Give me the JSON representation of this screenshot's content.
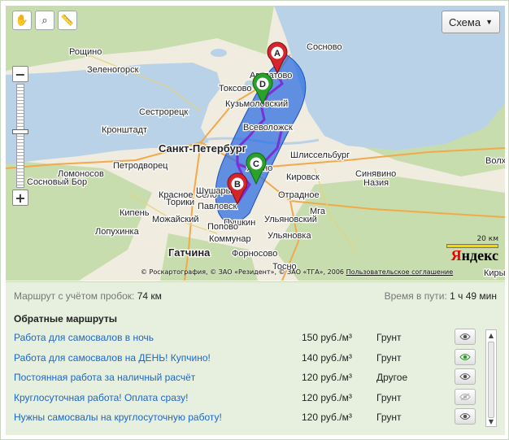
{
  "map": {
    "toolbar": [
      "hand-icon",
      "magnifier-icon",
      "ruler-icon"
    ],
    "map_type_label": "Схема",
    "places": [
      {
        "name": "Зеленогорск",
        "cls": ""
      },
      {
        "name": "Сестрорецк",
        "cls": ""
      },
      {
        "name": "Кронштадт",
        "cls": ""
      },
      {
        "name": "Санкт-Петербург",
        "cls": "big"
      },
      {
        "name": "Петродворец",
        "cls": ""
      },
      {
        "name": "Ломоносов",
        "cls": ""
      },
      {
        "name": "Сосновый Бор",
        "cls": ""
      },
      {
        "name": "Всеволожск",
        "cls": ""
      },
      {
        "name": "Токсово",
        "cls": ""
      },
      {
        "name": "Кузьмоловский",
        "cls": ""
      },
      {
        "name": "Шлиссельбург",
        "cls": ""
      },
      {
        "name": "Кировск",
        "cls": ""
      },
      {
        "name": "Отрадное",
        "cls": ""
      },
      {
        "name": "Пушкин",
        "cls": ""
      },
      {
        "name": "Павловск",
        "cls": ""
      },
      {
        "name": "Гатчина",
        "cls": "big"
      },
      {
        "name": "Коммунар",
        "cls": ""
      },
      {
        "name": "Тосно",
        "cls": ""
      },
      {
        "name": "Волхов",
        "cls": ""
      },
      {
        "name": "Назия",
        "cls": ""
      },
      {
        "name": "Мга",
        "cls": ""
      },
      {
        "name": "Ульяновка",
        "cls": ""
      },
      {
        "name": "Ульяновский",
        "cls": ""
      },
      {
        "name": "Форносово",
        "cls": ""
      },
      {
        "name": "Красное Село",
        "cls": ""
      },
      {
        "name": "Можайский",
        "cls": ""
      },
      {
        "name": "Кипень",
        "cls": ""
      },
      {
        "name": "Лопухинка",
        "cls": ""
      },
      {
        "name": "Торики",
        "cls": ""
      },
      {
        "name": "Попово",
        "cls": ""
      },
      {
        "name": "Шушары",
        "cls": ""
      },
      {
        "name": "Рощино",
        "cls": ""
      },
      {
        "name": "Агалатово",
        "cls": ""
      },
      {
        "name": "Янино",
        "cls": ""
      },
      {
        "name": "Синявино",
        "cls": ""
      },
      {
        "name": "Сосново",
        "cls": ""
      },
      {
        "name": "Кирыши",
        "cls": ""
      }
    ],
    "markers": [
      "A",
      "B",
      "C",
      "D"
    ],
    "scale_label": "20 км",
    "logo": "Яндекс",
    "copyright": "© Роскартография, © ЗАО «Резидент», © ЗАО «ТГА», 2006",
    "terms_link": "Пользовательское соглашение"
  },
  "summary": {
    "distance_label": "Маршрут с учётом пробок:",
    "distance_value": "74 км",
    "time_label": "Время в пути:",
    "time_value": "1 ч 49 мин"
  },
  "routes_heading": "Обратные маршруты",
  "routes": [
    {
      "name": "Работа для самосвалов в ночь",
      "price": "150 руб./м³",
      "cargo": "Грунт",
      "eye": "normal"
    },
    {
      "name": "Работа для самосвалов на ДЕНЬ! Купчино!",
      "price": "140 руб./м³",
      "cargo": "Грунт",
      "eye": "active"
    },
    {
      "name": "Постоянная работа за наличный расчёт",
      "price": "120 руб./м³",
      "cargo": "Другое",
      "eye": "normal"
    },
    {
      "name": "Круглосуточная работа! Оплата сразу!",
      "price": "120 руб./м³",
      "cargo": "Грунт",
      "eye": "disabled"
    },
    {
      "name": "Нужны самосвалы на круглосуточную работу!",
      "price": "120 руб./м³",
      "cargo": "Грунт",
      "eye": "normal"
    }
  ],
  "colors": {
    "water": "#b9d2e8",
    "land": "#f1ece0",
    "forest": "#c8ddae",
    "route": "#7b2fd6",
    "area": "#2f6fe0",
    "link": "#1a66c8",
    "panel": "#e7f0df"
  }
}
